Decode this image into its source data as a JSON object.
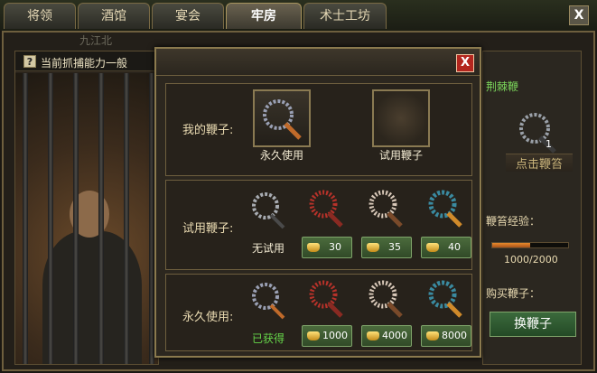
{
  "tabs": [
    {
      "label": "将领",
      "active": false
    },
    {
      "label": "酒馆",
      "active": false
    },
    {
      "label": "宴会",
      "active": false
    },
    {
      "label": "牢房",
      "active": true
    },
    {
      "label": "术士工坊",
      "active": false
    }
  ],
  "top_close": "X",
  "place_tag": "九江北",
  "capture": {
    "help": "?",
    "text": "当前抓捕能力一般"
  },
  "sidebar": {
    "thorn_label": "荆棘鞭",
    "thorn_count": "1",
    "whip_action": "点击鞭笞",
    "exp_label": "鞭笞经验：",
    "exp_value": "1000/2000",
    "exp_progress": 0.5,
    "buy_label": "购买鞭子：",
    "change_button": "换鞭子"
  },
  "modal": {
    "close": "X",
    "my_whip": {
      "label": "我的鞭子:",
      "slots": [
        "永久使用",
        "试用鞭子"
      ]
    },
    "trial": {
      "label": "试用鞭子:",
      "note": "无试用",
      "prices": [
        "30",
        "35",
        "40"
      ]
    },
    "permanent": {
      "label": "永久使用:",
      "note": "已获得",
      "prices": [
        "1000",
        "4000",
        "8000"
      ]
    }
  },
  "colors": {
    "accent_green": "#66d64a",
    "close_red": "#b3261e",
    "frame_gold": "#8b7a4e"
  },
  "icons": [
    "help-icon",
    "whip-icon",
    "gold-ingot-icon",
    "close-icon"
  ]
}
